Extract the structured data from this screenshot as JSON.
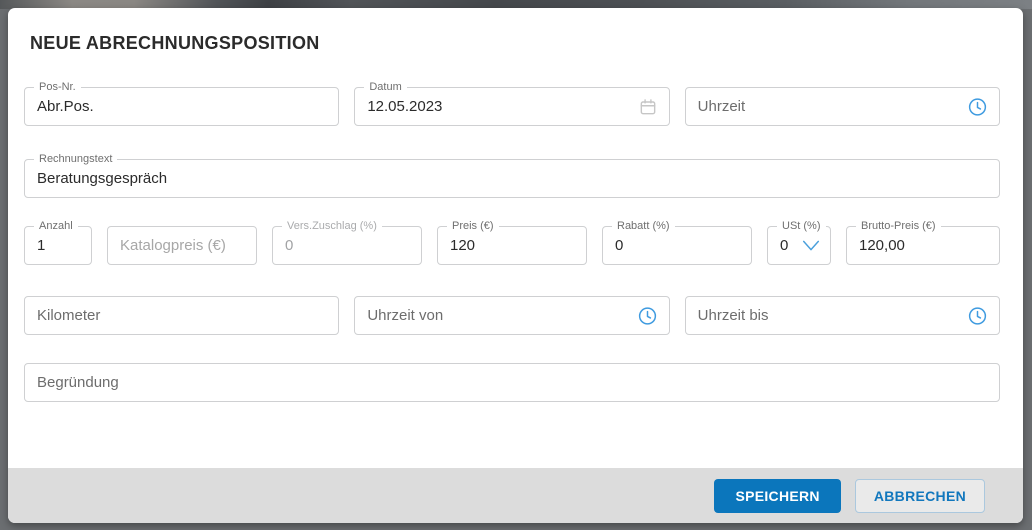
{
  "dialog": {
    "title": "NEUE ABRECHNUNGSPOSITION",
    "fields": {
      "pos_nr": {
        "label": "Pos-Nr.",
        "value": "Abr.Pos."
      },
      "datum": {
        "label": "Datum",
        "value": "12.05.2023",
        "icon": "calendar-icon"
      },
      "uhrzeit": {
        "placeholder": "Uhrzeit",
        "icon": "clock-icon"
      },
      "rechnungstext": {
        "label": "Rechnungstext",
        "value": "Beratungsgespräch"
      },
      "anzahl": {
        "label": "Anzahl",
        "value": "1"
      },
      "katalogpreis": {
        "placeholder": "Katalogpreis (€)"
      },
      "vers_zuschlag": {
        "label": "Vers.Zuschlag (%)",
        "value": "0",
        "state": "disabled"
      },
      "preis": {
        "label": "Preis (€)",
        "value": "120"
      },
      "rabatt": {
        "label": "Rabatt (%)",
        "value": "0"
      },
      "ust": {
        "label": "USt (%)",
        "value": "0",
        "icon": "chevron-down-icon"
      },
      "brutto_preis": {
        "label": "Brutto-Preis (€)",
        "value": "120,00"
      },
      "kilometer": {
        "placeholder": "Kilometer"
      },
      "uhrzeit_von": {
        "placeholder": "Uhrzeit von",
        "icon": "clock-icon"
      },
      "uhrzeit_bis": {
        "placeholder": "Uhrzeit bis",
        "icon": "clock-icon"
      },
      "begruendung": {
        "placeholder": "Begründung"
      }
    },
    "buttons": {
      "save": "SPEICHERN",
      "cancel": "ABBRECHEN"
    },
    "colors": {
      "accent_blue": "#0b76bc",
      "icon_blue": "#3f9be0",
      "footer_gray": "#dcdcdc",
      "field_border": "#cfd0d2",
      "label_gray": "#6f6f6f",
      "disabled_gray": "#a7a7a7"
    }
  }
}
